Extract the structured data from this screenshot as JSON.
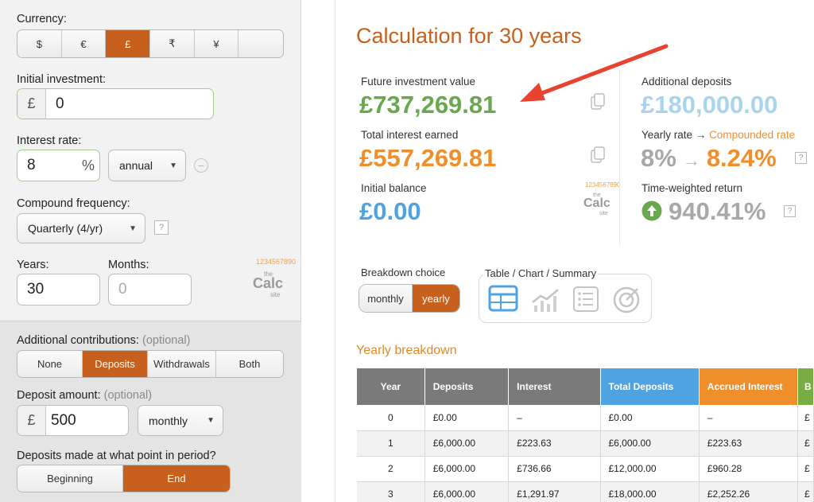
{
  "left": {
    "currency": {
      "label": "Currency:",
      "options": [
        "$",
        "€",
        "£",
        "₹",
        "¥",
        ""
      ],
      "selected_index": 2
    },
    "initial_investment": {
      "label": "Initial investment:",
      "prefix": "£",
      "value": "0"
    },
    "interest_rate": {
      "label": "Interest rate:",
      "value": "8",
      "suffix": "%",
      "period": "annual"
    },
    "compound_frequency": {
      "label": "Compound frequency:",
      "value": "Quarterly (4/yr)",
      "help": "?"
    },
    "years": {
      "label": "Years:",
      "value": "30"
    },
    "months": {
      "label": "Months:",
      "placeholder": "0"
    },
    "logo": {
      "digits": "1234567890",
      "the": "the",
      "calc": "Calc",
      "site": "site"
    },
    "contributions": {
      "label": "Additional contributions:",
      "optional": "(optional)",
      "options": [
        "None",
        "Deposits",
        "Withdrawals",
        "Both"
      ],
      "selected_index": 1
    },
    "deposit_amount": {
      "label": "Deposit amount:",
      "optional": "(optional)",
      "prefix": "£",
      "value": "500",
      "period": "monthly"
    },
    "deposit_timing": {
      "label": "Deposits made at what point in period?",
      "options": [
        "Beginning",
        "End"
      ],
      "selected_index": 1
    }
  },
  "results": {
    "title": "Calculation for 30 years",
    "future_value": {
      "label": "Future investment value",
      "value": "£737,269.81"
    },
    "total_interest": {
      "label": "Total interest earned",
      "value": "£557,269.81"
    },
    "initial_balance": {
      "label": "Initial balance",
      "value": "£0.00"
    },
    "additional_deposits": {
      "label": "Additional deposits",
      "value": "£180,000.00"
    },
    "yearly_rate": {
      "label": "Yearly rate →",
      "label_link": "Compounded rate",
      "rate": "8%",
      "arrow": "→",
      "compounded": "8.24%",
      "help": "?"
    },
    "twr": {
      "label": "Time-weighted return",
      "value": "940.41%",
      "help": "?"
    },
    "breakdown_choice": {
      "label": "Breakdown choice",
      "options": [
        "monthly",
        "yearly"
      ],
      "selected_index": 1
    },
    "view_choice": {
      "label": "Table / Chart / Summary"
    },
    "yearly_breakdown": "Yearly breakdown",
    "table": {
      "headers": [
        "Year",
        "Deposits",
        "Interest",
        "Total Deposits",
        "Accrued Interest",
        "B"
      ],
      "header_colors": [
        "#7a7a7a",
        "#7a7a7a",
        "#7a7a7a",
        "#4ea3e0",
        "#ef8f2c",
        "#78ad45"
      ],
      "rows": [
        [
          "0",
          "£0.00",
          "–",
          "£0.00",
          "–",
          "£"
        ],
        [
          "1",
          "£6,000.00",
          "£223.63",
          "£6,000.00",
          "£223.63",
          "£"
        ],
        [
          "2",
          "£6,000.00",
          "£736.66",
          "£12,000.00",
          "£960.28",
          "£"
        ],
        [
          "3",
          "£6,000.00",
          "£1,291.97",
          "£18,000.00",
          "£2,252.26",
          "£"
        ]
      ]
    }
  },
  "colors": {
    "accent": "#c8601d",
    "green": "#6aa84f",
    "orange": "#ef8f2c",
    "blue": "#4ea3e0",
    "light_blue": "#a8d4ee",
    "grey": "#a8a8a8",
    "arrow": "#e8432f"
  }
}
